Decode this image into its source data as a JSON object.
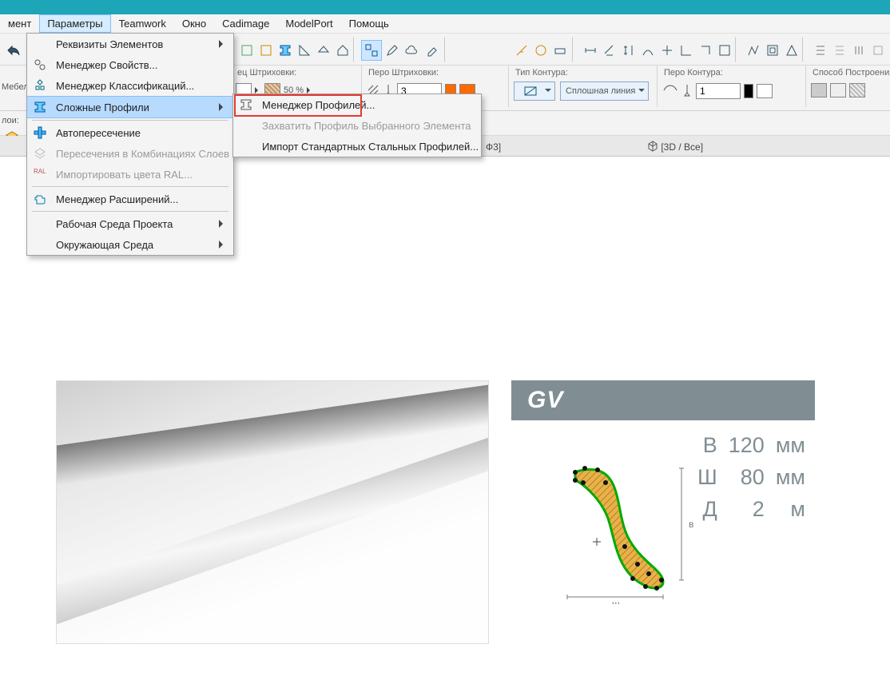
{
  "menubar": {
    "items": [
      "мент",
      "Параметры",
      "Teamwork",
      "Окно",
      "Cadimage",
      "ModelPort",
      "Помощь"
    ],
    "active_index": 1
  },
  "dropdown_main": {
    "items": [
      {
        "label": "Реквизиты Элементов",
        "sub": true,
        "icon": ""
      },
      {
        "label": "Менеджер Свойств...",
        "icon": "props"
      },
      {
        "label": "Менеджер Классификаций...",
        "icon": "class"
      },
      {
        "label": "Сложные Профили",
        "sub": true,
        "highlight": true,
        "icon": "ibeam"
      },
      {
        "label": "Автопересечение",
        "icon": "auto",
        "checked": true
      },
      {
        "label": "Пересечения в Комбинациях Слоев",
        "disabled": true,
        "icon": "layers"
      },
      {
        "label": "Импортировать цвета RAL...",
        "disabled": true,
        "icon": "ral"
      },
      {
        "label": "Менеджер Расширений...",
        "icon": "ext"
      },
      {
        "label": "Рабочая Среда Проекта",
        "sub": true
      },
      {
        "label": "Окружающая Среда",
        "sub": true
      }
    ]
  },
  "dropdown_sub": {
    "items": [
      {
        "label": "Менеджер Профилей...",
        "icon": "ibeam",
        "highlight_red": true
      },
      {
        "label": "Захватить Профиль Выбранного Элемента",
        "disabled": true
      },
      {
        "label": "Импорт Стандартных Стальных Профилей..."
      }
    ]
  },
  "optbar": {
    "hatch_sample_label": "ец Штриховки:",
    "hatch_value": "50 %",
    "pen_hatch_label": "Перо Штриховки:",
    "pen_value": "3",
    "contour_type_label": "Тип Контура:",
    "contour_type_value": "Сплошная линия",
    "contour_pen_label": "Перо Контура:",
    "contour_pen_value": "1",
    "build_label": "Способ Построения:"
  },
  "left": {
    "label1": "лои:",
    "label2": "Мебел"
  },
  "tabs": {
    "t1": "Ф3]",
    "t2": "[3D / Все]"
  },
  "gv": {
    "title": "GV",
    "rows": [
      {
        "k": "В",
        "v": "120",
        "u": "мм"
      },
      {
        "k": "Ш",
        "v": "80",
        "u": "мм"
      },
      {
        "k": "Д",
        "v": "2",
        "u": "м"
      }
    ],
    "axis_w": "ш",
    "axis_h": "в"
  }
}
